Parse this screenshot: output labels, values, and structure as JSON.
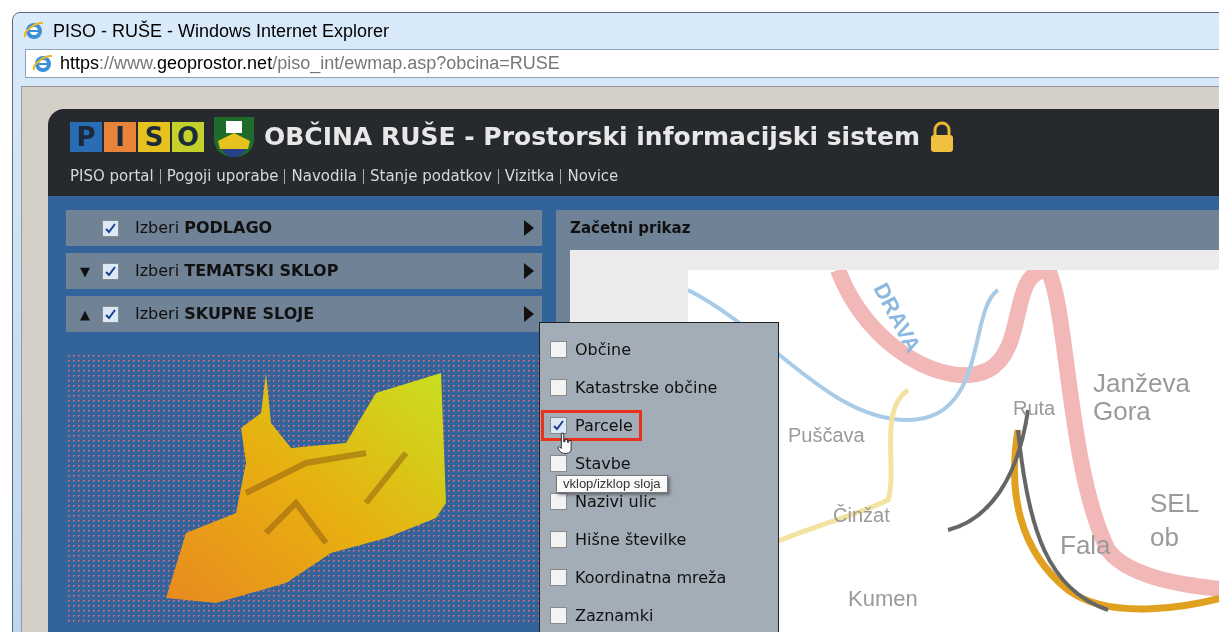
{
  "window": {
    "title": "PISO - RUŠE - Windows Internet Explorer"
  },
  "address_bar": {
    "scheme": "https",
    "domain_prefix": "://www.",
    "domain": "geoprostor.net",
    "path": "/piso_int/ewmap.asp?obcina=RUSE"
  },
  "header": {
    "logo_letters": [
      {
        "letter": "P",
        "color": "#2a6db5"
      },
      {
        "letter": "I",
        "color": "#e8843a"
      },
      {
        "letter": "S",
        "color": "#e6c21f"
      },
      {
        "letter": "O",
        "color": "#c3d12a"
      }
    ],
    "title": "OBČINA RUŠE - Prostorski informacijski sistem",
    "nav": [
      "PISO portal",
      "Pogoji uporabe",
      "Navodila",
      "Stanje podatkov",
      "Vizitka",
      "Novice"
    ]
  },
  "panels": [
    {
      "prefix": "Izberi",
      "name": "PODLAGO",
      "checked": true
    },
    {
      "prefix": "Izberi",
      "name": "TEMATSKI SKLOP",
      "checked": true,
      "toggle": "▼"
    },
    {
      "prefix": "Izberi",
      "name": "SKUPNE SLOJE",
      "checked": true,
      "toggle": "▲"
    }
  ],
  "layers_menu": [
    {
      "label": "Občine",
      "checked": false,
      "highlighted": false
    },
    {
      "label": "Katastrske občine",
      "checked": false,
      "highlighted": false
    },
    {
      "label": "Parcele",
      "checked": true,
      "highlighted": true
    },
    {
      "label": "Stavbe",
      "checked": false,
      "highlighted": false
    },
    {
      "label": "Nazivi ulic",
      "checked": false,
      "highlighted": false
    },
    {
      "label": "Hišne številke",
      "checked": false,
      "highlighted": false
    },
    {
      "label": "Koordinatna mreža",
      "checked": false,
      "highlighted": false
    },
    {
      "label": "Zaznamki",
      "checked": false,
      "highlighted": false
    }
  ],
  "tooltip": "vklop/izklop sloja",
  "map_panel": {
    "title": "Začetni prikaz",
    "labels": [
      "DRAVA",
      "Janževa",
      "Gora",
      "Ruta",
      "Puščava",
      "Činžat",
      "SEL",
      "ob",
      "Fala",
      "Kumen"
    ]
  }
}
